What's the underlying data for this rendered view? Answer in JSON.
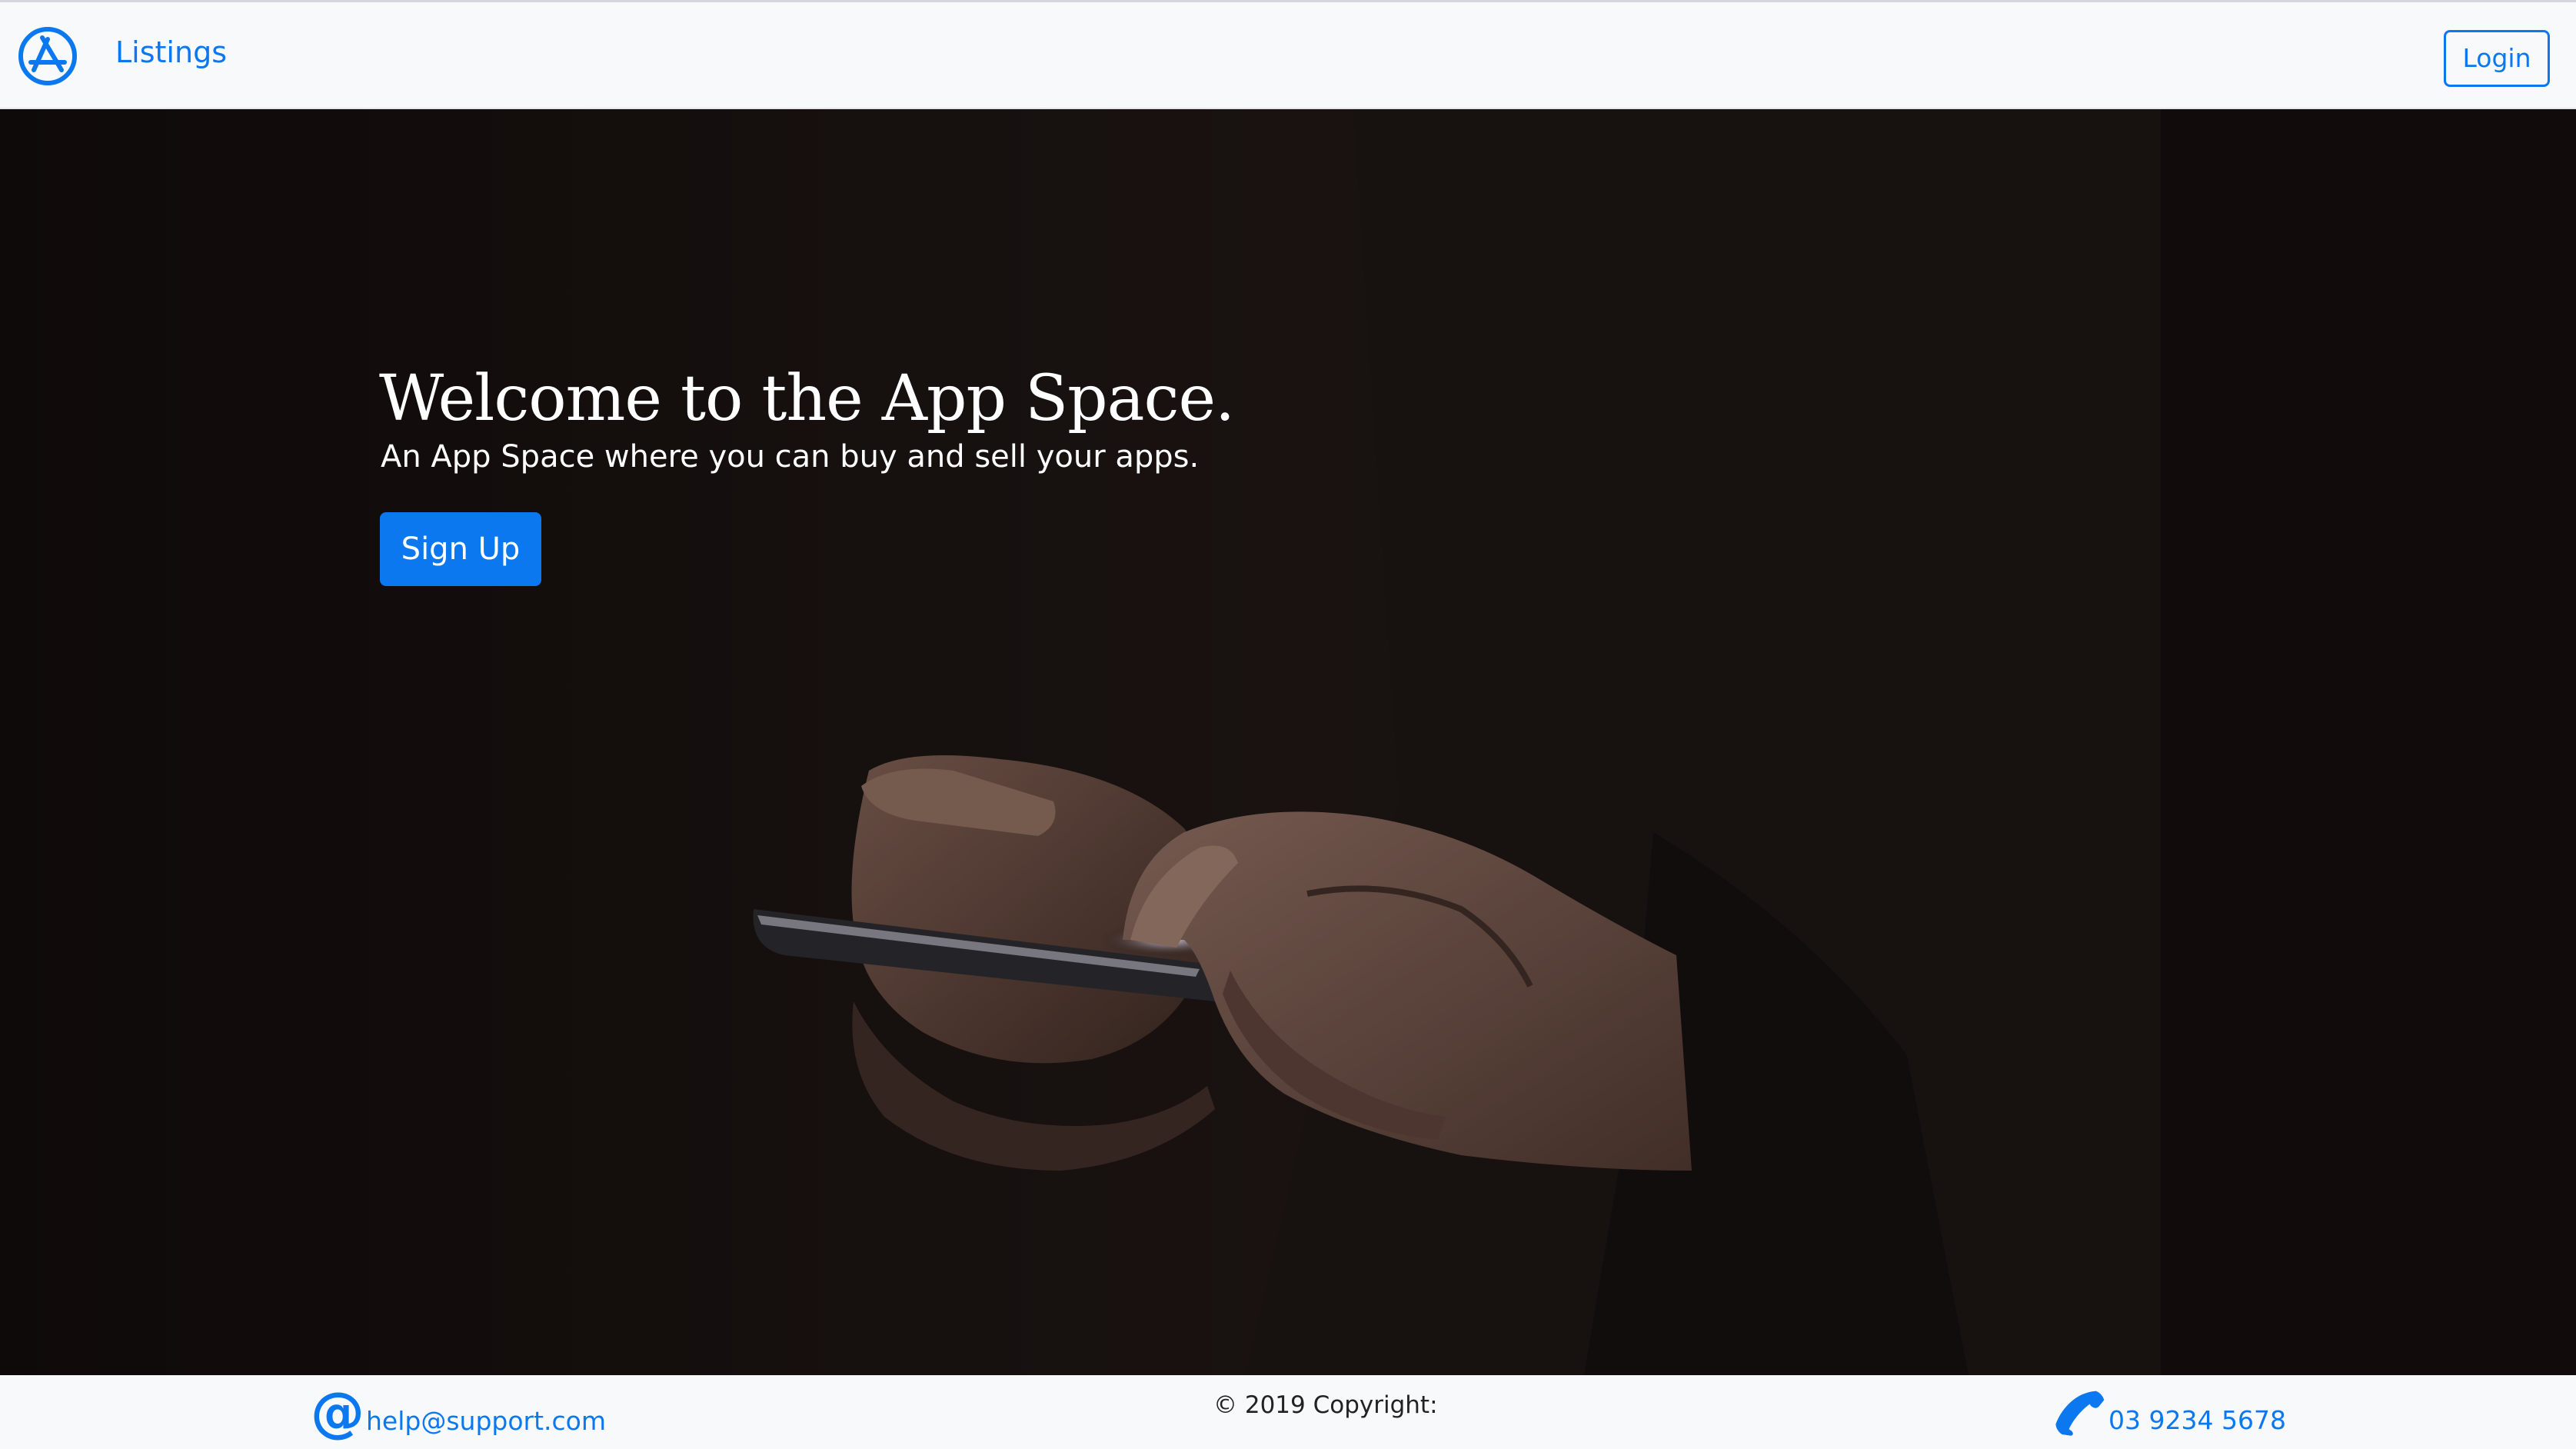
{
  "nav": {
    "brand_icon": "app-store-icon",
    "listings_label": "Listings",
    "login_label": "Login"
  },
  "hero": {
    "title": "Welcome to the App Space.",
    "subtitle": "An App Space where you can buy and sell your apps.",
    "signup_label": "Sign Up",
    "background": "photo of hands holding a smartphone"
  },
  "footer": {
    "email_icon": "at-icon",
    "email_symbol": "@",
    "email": "help@support.com",
    "copyright": "© 2019 Copyright:",
    "phone_icon": "phone-icon",
    "phone": "03 9234 5678"
  },
  "colors": {
    "accent": "#0b78f0",
    "nav_bg": "#f8f9fb",
    "hero_bg": "#151010"
  }
}
